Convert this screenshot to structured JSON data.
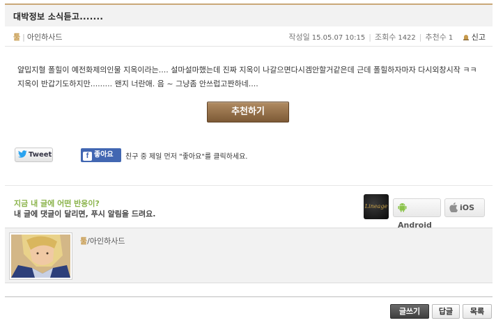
{
  "post": {
    "title": "대박정보 소식듣고.......",
    "author": {
      "server": "툴",
      "separator": "|",
      "name": "아인하사드"
    },
    "meta": {
      "date_label": "작성일",
      "date": "15.05.07 10:15",
      "views_label": "조회수",
      "views": "1422",
      "recommends_label": "추천수",
      "recommends": "1",
      "report_label": "신고"
    },
    "body": "얄밉지혈 폴힐이 예전화제의인물 지옥이라는.... 설마설마했는데 진짜 지옥이 나갈으면다시겜안할거같은데 근데 폴힐하자마자 다시외창시작 ㅋㅋ 지옥이 반갑기도하지만......... 왠지 너란애. 음 ~ 그냥좀 안쓰럽고짠하네....",
    "recommend_button": "추천하기"
  },
  "social": {
    "tweet_label": "Tweet",
    "fb_like_label": "좋아요",
    "fb_prompt": "친구 중 제일 먼저 \"좋아요\"를 클릭하세요."
  },
  "push": {
    "title": "지금 내 글에 어떤 반응이?",
    "subtitle": "내 글에 댓글이 달리면, 푸시 알림을 드려요.",
    "lineage_label": "Lineage",
    "android_label": "Android",
    "ios_label": "iOS"
  },
  "comment": {
    "server": "툴",
    "separator": "/",
    "name": "아인하사드"
  },
  "actions": {
    "write_label": "글쓰기",
    "reply_label": "답글",
    "list_label": "목록"
  }
}
